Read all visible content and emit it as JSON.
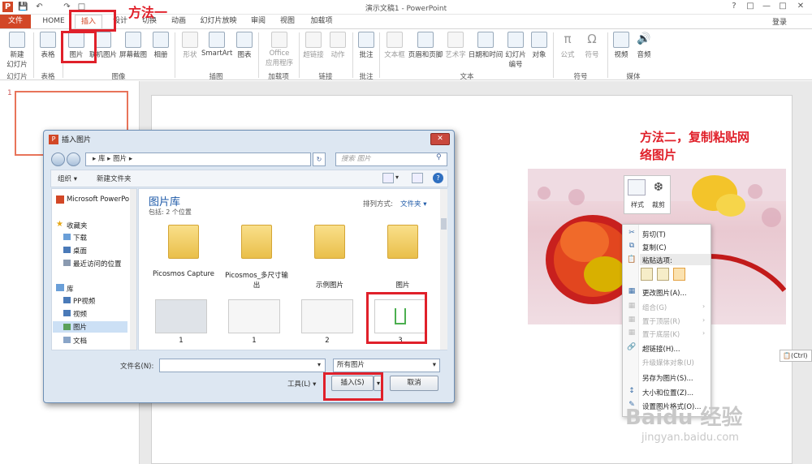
{
  "window": {
    "title": "演示文稿1 - PowerPoint",
    "login": "登录"
  },
  "quick_access": {
    "icons": [
      "powerpoint-logo-icon",
      "save-icon",
      "undo-icon",
      "redo-icon",
      "start-from-beginning-icon"
    ]
  },
  "tabs": [
    {
      "label": "文件"
    },
    {
      "label": "HOME"
    },
    {
      "label": "插入"
    },
    {
      "label": "设计"
    },
    {
      "label": "切换"
    },
    {
      "label": "动画"
    },
    {
      "label": "幻灯片放映"
    },
    {
      "label": "审阅"
    },
    {
      "label": "视图"
    },
    {
      "label": "加载项"
    }
  ],
  "ribbon": {
    "new_slide_1": "新建",
    "new_slide_2": "幻灯片",
    "table": "表格",
    "picture": "图片",
    "online_picture": "联机图片",
    "screenshot": "屏幕截图",
    "album": "相册",
    "shapes": "形状",
    "smartart": "SmartArt",
    "chart": "图表",
    "office_apps_1": "Office",
    "office_apps_2": "应用程序",
    "hyperlink": "超链接",
    "action": "动作",
    "comment": "批注",
    "textbox": "文本框",
    "header_footer": "页眉和页脚",
    "wordart": "艺术字",
    "datetime": "日期和时间",
    "slide_number_1": "幻灯片",
    "slide_number_2": "编号",
    "object": "对象",
    "equation": "公式",
    "symbol": "符号",
    "video": "视频",
    "audio": "音频",
    "groups": [
      "幻灯片",
      "表格",
      "图像",
      "插图",
      "加载项",
      "链接",
      "批注",
      "文本",
      "符号",
      "媒体"
    ]
  },
  "annotations": {
    "method1": "方法一",
    "method2_line1": "方法二，复制粘贴网",
    "method2_line2": "络图片"
  },
  "thumbnail": {
    "slide_number": "1"
  },
  "dialog": {
    "title": "插入图片",
    "breadcrumb": [
      "库",
      "图片"
    ],
    "search_placeholder": "搜索 图片",
    "organize": "组织 ▾",
    "new_folder": "新建文件夹",
    "nav": {
      "ppt": "Microsoft PowerPo",
      "favorites": "收藏夹",
      "fav_items": [
        "下载",
        "桌面",
        "最近访问的位置"
      ],
      "libraries": "库",
      "lib_items": [
        "PP视频",
        "视频",
        "图片",
        "文档"
      ]
    },
    "library_title": "图片库",
    "includes": "包括: 2 个位置",
    "sort_label": "排列方式:",
    "sort_value": "文件夹 ▾",
    "folders": [
      "Picosmos Capture",
      "Picosmos_多尺寸输出",
      "示例图片",
      "图片"
    ],
    "files": [
      "1",
      "1",
      "2",
      "3"
    ],
    "filename_label": "文件名(N):",
    "filename_value": "",
    "filetype": "所有图片",
    "tools": "工具(L)",
    "insert": "插入(S)",
    "cancel": "取消"
  },
  "mini_toolbar": {
    "style": "样式",
    "crop": "裁剪"
  },
  "context_menu": {
    "items": [
      {
        "label": "剪切(T)",
        "icon": "cut-icon",
        "enabled": true
      },
      {
        "label": "复制(C)",
        "icon": "copy-icon",
        "enabled": true
      },
      {
        "label": "粘贴选项:",
        "icon": "paste-icon",
        "enabled": true
      },
      {
        "label": "更改图片(A)...",
        "icon": "change-picture-icon",
        "enabled": true
      },
      {
        "label": "组合(G)",
        "icon": "group-icon",
        "enabled": false
      },
      {
        "label": "置于顶层(R)",
        "icon": "bring-front-icon",
        "enabled": false
      },
      {
        "label": "置于底层(K)",
        "icon": "send-back-icon",
        "enabled": false
      },
      {
        "label": "超链接(H)...",
        "icon": "hyperlink-icon",
        "enabled": true
      },
      {
        "label": "升级媒体对象(U)",
        "icon": "",
        "enabled": false
      },
      {
        "label": "另存为图片(S)...",
        "icon": "",
        "enabled": true
      },
      {
        "label": "大小和位置(Z)...",
        "icon": "size-icon",
        "enabled": true
      },
      {
        "label": "设置图片格式(O)...",
        "icon": "format-icon",
        "enabled": true
      }
    ]
  },
  "paste_tag": "(Ctrl)",
  "watermark": {
    "line1": "Baidu 经验",
    "line2": "jingyan.baidu.com"
  }
}
